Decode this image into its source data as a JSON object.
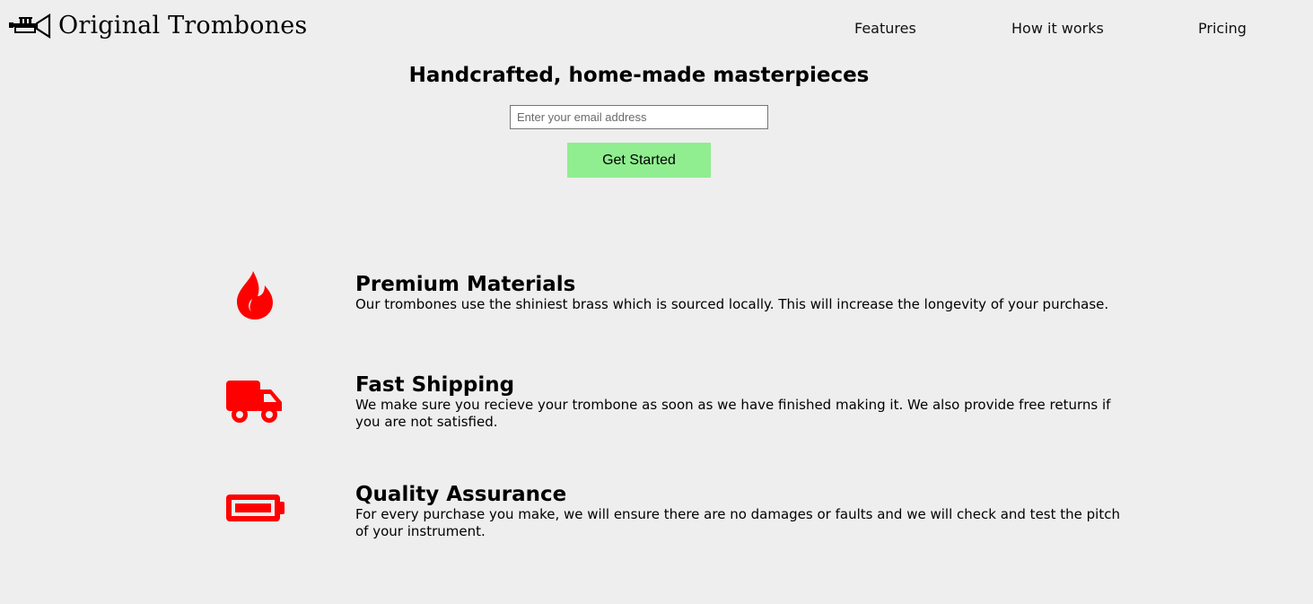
{
  "brand": {
    "name": "Original Trombones",
    "logo_icon": "trumpet-icon"
  },
  "nav": {
    "items": [
      {
        "label": "Features"
      },
      {
        "label": "How it works"
      },
      {
        "label": "Pricing"
      }
    ]
  },
  "hero": {
    "title": "Handcrafted, home-made masterpieces",
    "email_placeholder": "Enter your email address",
    "email_value": "",
    "button_label": "Get Started"
  },
  "colors": {
    "accent_icon": "#ff0000",
    "button_bg": "#90ee90",
    "page_bg": "#eeeeee"
  },
  "features": [
    {
      "icon": "fire-icon",
      "title": "Premium Materials",
      "description": "Our trombones use the shiniest brass which is sourced locally. This will increase the longevity of your purchase."
    },
    {
      "icon": "truck-icon",
      "title": "Fast Shipping",
      "description": "We make sure you recieve your trombone as soon as we have finished making it. We also provide free returns if you are not satisfied."
    },
    {
      "icon": "battery-full-icon",
      "title": "Quality Assurance",
      "description": "For every purchase you make, we will ensure there are no damages or faults and we will check and test the pitch of your instrument."
    }
  ]
}
